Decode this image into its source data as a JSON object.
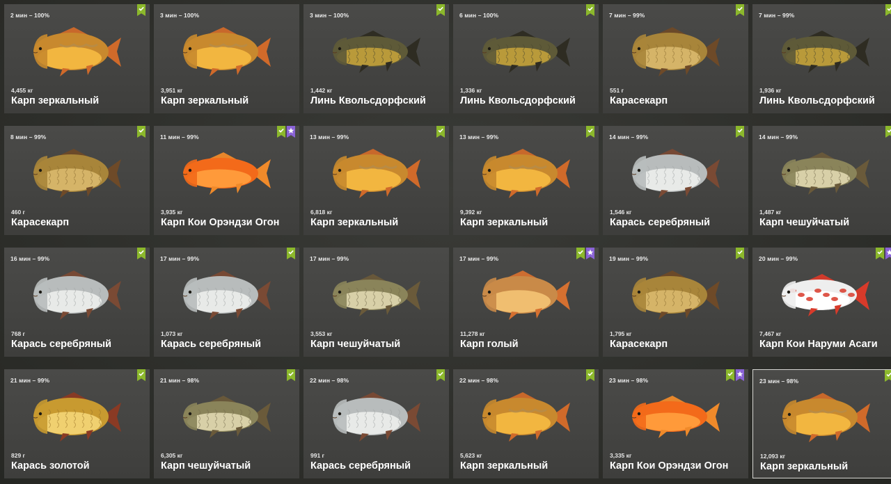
{
  "catches": [
    {
      "time": "2 мин – 100%",
      "weight": "4,455 кг",
      "name": "Карп зеркальный",
      "fish": "mirror",
      "badges": [
        "check"
      ]
    },
    {
      "time": "3 мин – 100%",
      "weight": "3,951 кг",
      "name": "Карп зеркальный",
      "fish": "mirror",
      "badges": []
    },
    {
      "time": "3 мин – 100%",
      "weight": "1,442 кг",
      "name": "Линь Квольсдорфский",
      "fish": "tench",
      "badges": [
        "check"
      ]
    },
    {
      "time": "6 мин – 100%",
      "weight": "1,336 кг",
      "name": "Линь Квольсдорфский",
      "fish": "tench",
      "badges": [
        "check"
      ]
    },
    {
      "time": "7 мин – 99%",
      "weight": "551 г",
      "name": "Карасекарп",
      "fish": "crucian",
      "badges": [
        "check"
      ]
    },
    {
      "time": "7 мин – 99%",
      "weight": "1,936 кг",
      "name": "Линь Квольсдорфский",
      "fish": "tench",
      "badges": [
        "check"
      ]
    },
    {
      "time": "8 мин – 99%",
      "weight": "460 г",
      "name": "Карасекарп",
      "fish": "crucian",
      "badges": [
        "check"
      ]
    },
    {
      "time": "11 мин – 99%",
      "weight": "3,935 кг",
      "name": "Карп Кои Орэндзи Огон",
      "fish": "koi",
      "badges": [
        "check",
        "star"
      ]
    },
    {
      "time": "13 мин – 99%",
      "weight": "6,818 кг",
      "name": "Карп зеркальный",
      "fish": "mirror",
      "badges": [
        "check"
      ]
    },
    {
      "time": "13 мин – 99%",
      "weight": "9,392 кг",
      "name": "Карп зеркальный",
      "fish": "mirror",
      "badges": [
        "check"
      ]
    },
    {
      "time": "14 мин – 99%",
      "weight": "1,546 кг",
      "name": "Карась серебряный",
      "fish": "silver",
      "badges": [
        "check"
      ]
    },
    {
      "time": "14 мин – 99%",
      "weight": "1,487 кг",
      "name": "Карп чешуйчатый",
      "fish": "common",
      "badges": [
        "check"
      ]
    },
    {
      "time": "16 мин – 99%",
      "weight": "768 г",
      "name": "Карась серебряный",
      "fish": "silver",
      "badges": [
        "check"
      ]
    },
    {
      "time": "17 мин – 99%",
      "weight": "1,073 кг",
      "name": "Карась серебряный",
      "fish": "silver",
      "badges": [
        "check"
      ]
    },
    {
      "time": "17 мин – 99%",
      "weight": "3,553 кг",
      "name": "Карп чешуйчатый",
      "fish": "common",
      "badges": []
    },
    {
      "time": "17 мин – 99%",
      "weight": "11,278 кг",
      "name": "Карп голый",
      "fish": "leather",
      "badges": [
        "check",
        "star"
      ]
    },
    {
      "time": "19 мин – 99%",
      "weight": "1,795 кг",
      "name": "Карасекарп",
      "fish": "crucian",
      "badges": [
        "check"
      ]
    },
    {
      "time": "20 мин – 99%",
      "weight": "7,467 кг",
      "name": "Карп Кои Наруми Асаги",
      "fish": "koiwhite",
      "badges": [
        "check",
        "star"
      ]
    },
    {
      "time": "21 мин – 99%",
      "weight": "829 г",
      "name": "Карась золотой",
      "fish": "gold",
      "badges": [
        "check"
      ]
    },
    {
      "time": "21 мин – 98%",
      "weight": "6,305 кг",
      "name": "Карп чешуйчатый",
      "fish": "common",
      "badges": [
        "check"
      ]
    },
    {
      "time": "22 мин – 98%",
      "weight": "991 г",
      "name": "Карась серебряный",
      "fish": "silver",
      "badges": [
        "check"
      ]
    },
    {
      "time": "22 мин – 98%",
      "weight": "5,623 кг",
      "name": "Карп зеркальный",
      "fish": "mirror",
      "badges": [
        "check"
      ]
    },
    {
      "time": "23 мин – 98%",
      "weight": "3,335 кг",
      "name": "Карп Кои Орэндзи Огон",
      "fish": "koi",
      "badges": [
        "check",
        "star"
      ]
    },
    {
      "time": "23 мин – 98%",
      "weight": "12,093 кг",
      "name": "Карп зеркальный",
      "fish": "mirror",
      "badges": [
        "check"
      ],
      "selected": true
    }
  ],
  "colors": {
    "badge_check": "#8cb82c",
    "badge_star": "#8a63d6"
  }
}
